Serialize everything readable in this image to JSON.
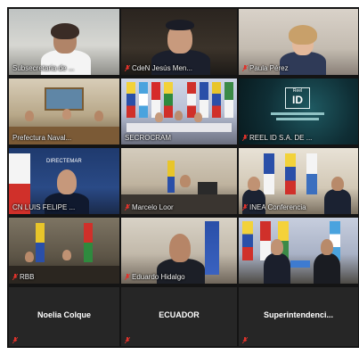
{
  "colors": {
    "background": "#141414",
    "active_speaker": "#d8e82b",
    "muted_icon": "#e0322b"
  },
  "participants": [
    {
      "name": "Subsecretaria de ...",
      "muted": false
    },
    {
      "name": "CdeN Jesús Men...",
      "muted": true
    },
    {
      "name": "Paula Pérez",
      "muted": true
    },
    {
      "name": "Prefectura Naval...",
      "muted": false
    },
    {
      "name": "SECROCRAM",
      "muted": false,
      "active": true
    },
    {
      "name": "REEL ID S.A. DE ...",
      "muted": true
    },
    {
      "name": "CN LUIS FELIPE ...",
      "muted": false
    },
    {
      "name": "Marcelo Loor",
      "muted": true
    },
    {
      "name": "INEA Conferencia",
      "muted": true
    },
    {
      "name": "RBB",
      "muted": true
    },
    {
      "name": "Eduardo Hidalgo",
      "muted": true
    },
    {
      "name": "",
      "muted": true
    },
    {
      "name": "Noelia Colque",
      "muted": true
    },
    {
      "name": "ECUADOR",
      "muted": true
    },
    {
      "name": "Superintendenci...",
      "muted": true
    }
  ],
  "tile_texts": {
    "reel_logo": "ID",
    "reel_small": "Reel",
    "uniform_caption": "DIRECTEMAR"
  }
}
